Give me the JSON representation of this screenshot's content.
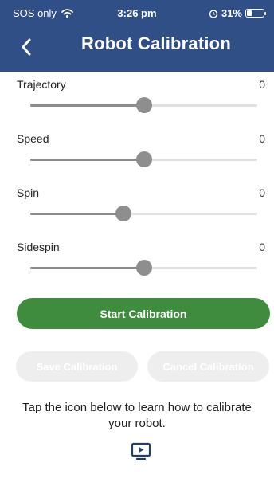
{
  "status_bar": {
    "carrier": "SOS only",
    "time": "3:26 pm",
    "battery": "31%",
    "battery_level": 0.31
  },
  "header": {
    "title": "Robot Calibration",
    "back_icon": "chevron-left-icon",
    "background_color": "#2f4f86"
  },
  "sliders": [
    {
      "label": "Trajectory",
      "value": "0",
      "position": 0.5
    },
    {
      "label": "Speed",
      "value": "0",
      "position": 0.5
    },
    {
      "label": "Spin",
      "value": "0",
      "position": 0.41
    },
    {
      "label": "Sidespin",
      "value": "0",
      "position": 0.5
    }
  ],
  "actions": {
    "start_label": "Start Calibration",
    "save_label": "Save Calibration",
    "cancel_label": "Cancel Calibration",
    "primary_color": "#3f8c3e"
  },
  "help": {
    "text": "Tap the icon below to learn how to calibrate your robot.",
    "icon": "video-play-icon"
  }
}
